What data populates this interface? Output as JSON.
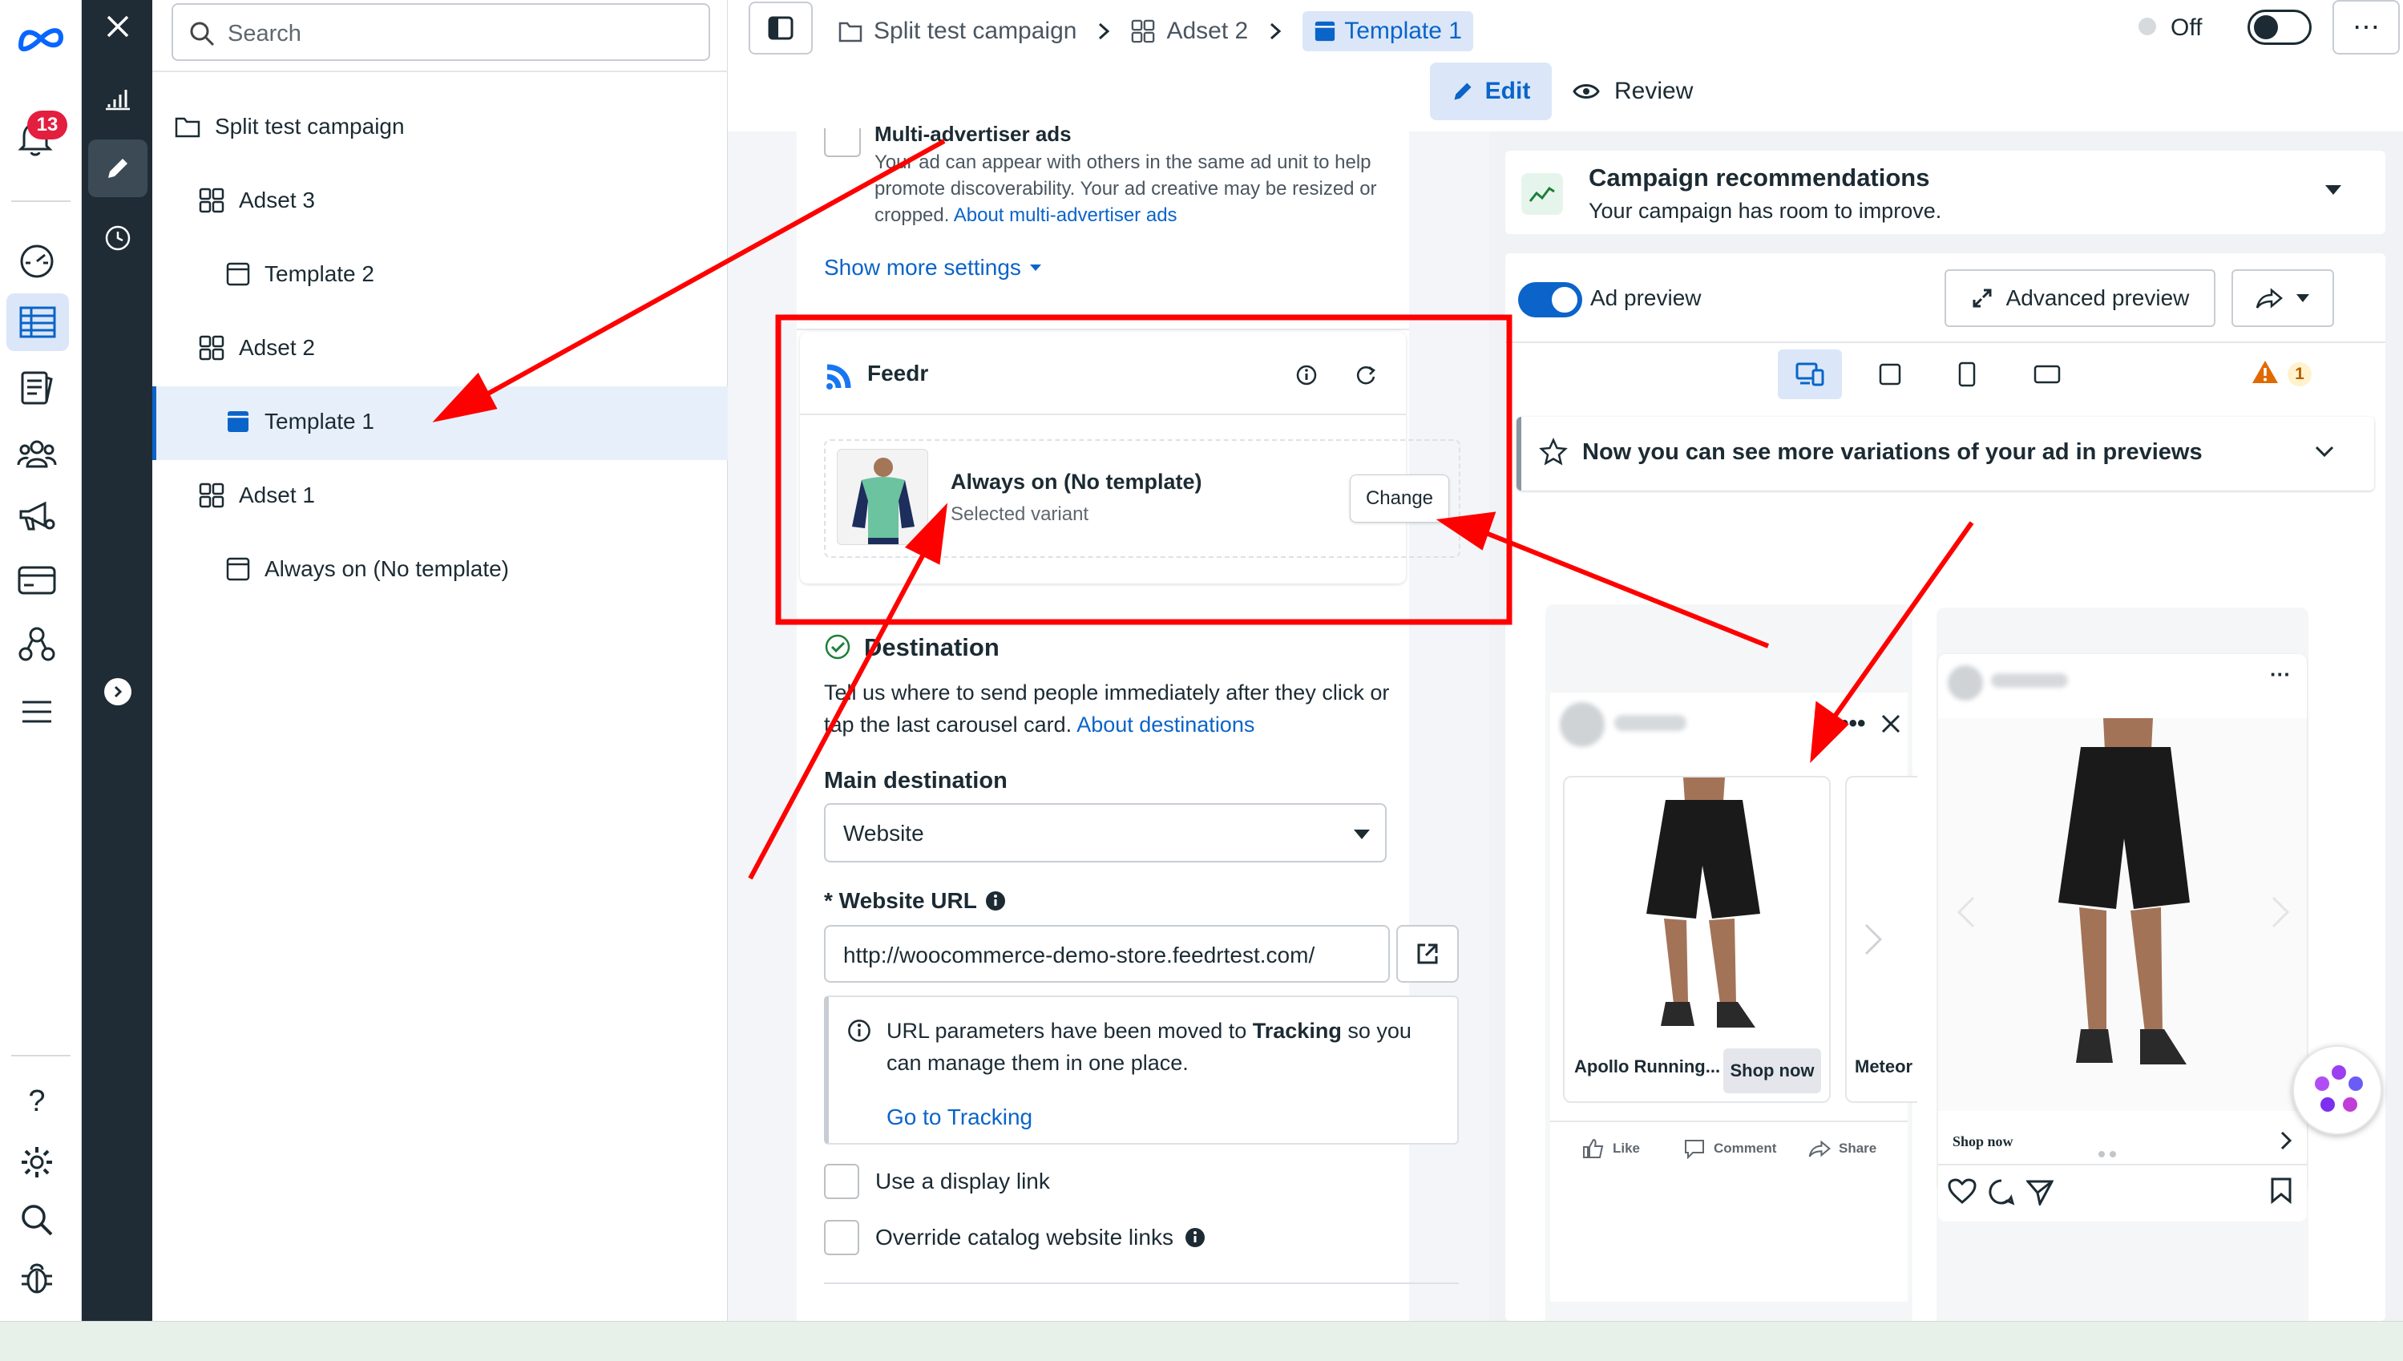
{
  "search": {
    "placeholder": "Search"
  },
  "notifications": {
    "count": "13"
  },
  "tree": [
    {
      "label": "Split test campaign",
      "kind": "folder"
    },
    {
      "label": "Adset 3",
      "kind": "adset"
    },
    {
      "label": "Template 2",
      "kind": "template"
    },
    {
      "label": "Adset 2",
      "kind": "adset"
    },
    {
      "label": "Template 1",
      "kind": "template",
      "selected": true
    },
    {
      "label": "Adset 1",
      "kind": "adset"
    },
    {
      "label": "Always on (No template)",
      "kind": "template"
    }
  ],
  "breadcrumb": {
    "campaign": "Split test campaign",
    "adset": "Adset 2",
    "ad": "Template 1"
  },
  "toggle_status": {
    "label": "Off"
  },
  "modes": {
    "edit": "Edit",
    "review": "Review"
  },
  "multi_advertiser": {
    "title": "Multi-advertiser ads",
    "line1": "Your ad can appear with others in the same ad unit to help",
    "line2": "promote discoverability. Your ad creative may be resized or",
    "line3": "cropped.",
    "link": "About multi-advertiser ads"
  },
  "show_more": "Show more settings",
  "feedr": {
    "name": "Feedr",
    "variant_title": "Always on (No template)",
    "variant_sub": "Selected variant",
    "change": "Change"
  },
  "destination": {
    "title": "Destination",
    "desc1": "Tell us where to send people immediately after they click or",
    "desc2": "tap the last carousel card.",
    "link": "About destinations",
    "main_label": "Main destination",
    "main_value": "Website",
    "url_label": "* Website URL",
    "url_value": "http://woocommerce-demo-store.feedrtest.com/",
    "notice_pre": "URL parameters have been moved to",
    "notice_bold": "Tracking",
    "notice_post": "so you",
    "notice_line2": "can manage them in one place.",
    "notice_link": "Go to Tracking",
    "display_link": "Use a display link",
    "override": "Override catalog website links"
  },
  "recommendations": {
    "title": "Campaign recommendations",
    "subtitle": "Your campaign has room to improve."
  },
  "preview": {
    "label": "Ad preview",
    "advanced": "Advanced preview",
    "warning_count": "1",
    "variations": "Now you can see more variations of your ad in previews"
  },
  "fb_card": {
    "product": "Apollo Running...",
    "cta": "Shop now",
    "next_product": "Meteor",
    "like": "Like",
    "comment": "Comment",
    "share": "Share"
  },
  "ig_card": {
    "cta": "Shop now"
  },
  "colors": {
    "accent": "#0a64c9",
    "annotation": "#ff0000",
    "rail": "#1f2c35"
  }
}
